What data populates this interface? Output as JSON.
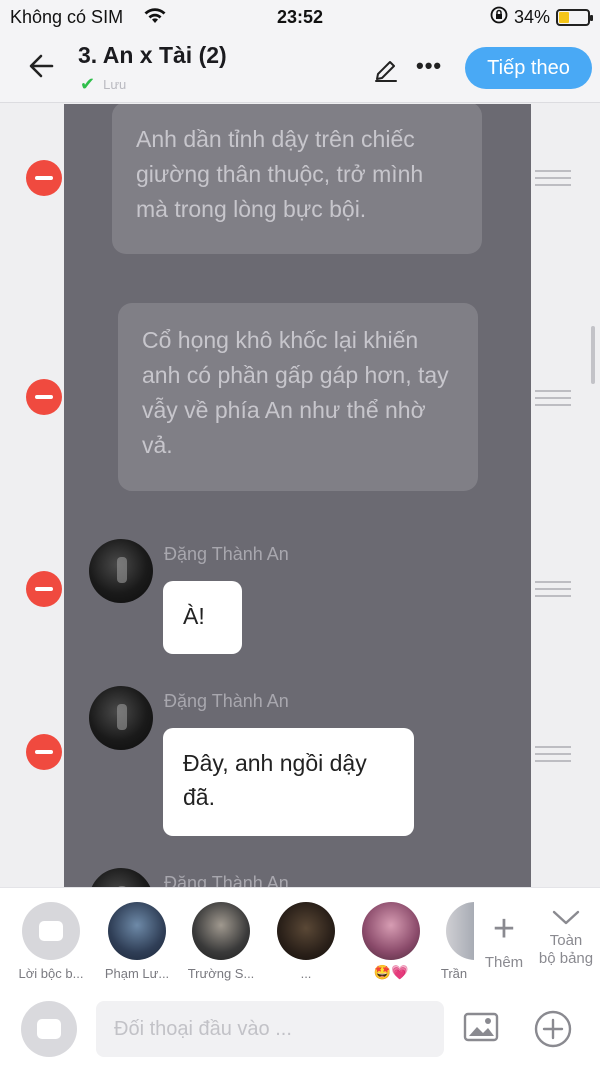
{
  "status_bar": {
    "carrier": "Không có SIM",
    "time": "23:52",
    "battery": "34%",
    "battery_level": 0.34
  },
  "header": {
    "title": "3. An x Tài (2)",
    "subtitle": "Lưu",
    "next_label": "Tiếp theo",
    "accent": "#49a9f5"
  },
  "messages": [
    {
      "type": "narration",
      "text": "Anh dần tỉnh dậy trên chiếc giường thân thuộc, trở mình mà trong lòng bực bội."
    },
    {
      "type": "narration",
      "text": "Cổ họng khô khốc lại khiến anh có phần gấp gáp hơn, tay vẫy về phía An như thể nhờ vả."
    },
    {
      "type": "dialogue",
      "speaker": "Đặng Thành An",
      "text": "À!"
    },
    {
      "type": "dialogue",
      "speaker": "Đặng Thành An",
      "text": "Đây, anh ngồi dậy đã."
    },
    {
      "type": "dialogue",
      "speaker": "Đặng Thành An",
      "text": ""
    }
  ],
  "characters": [
    {
      "name": "Lời bộc b..."
    },
    {
      "name": "Phạm Lư..."
    },
    {
      "name": "Trường S..."
    },
    {
      "name": "..."
    },
    {
      "name": "",
      "emoji": "🤩💗"
    },
    {
      "name": "Trần"
    }
  ],
  "actions": {
    "add_label": "Thêm",
    "all_label_line1": "Toàn",
    "all_label_line2": "bộ bảng"
  },
  "composer": {
    "placeholder": "Đối thoại đầu vào ...",
    "value": ""
  }
}
